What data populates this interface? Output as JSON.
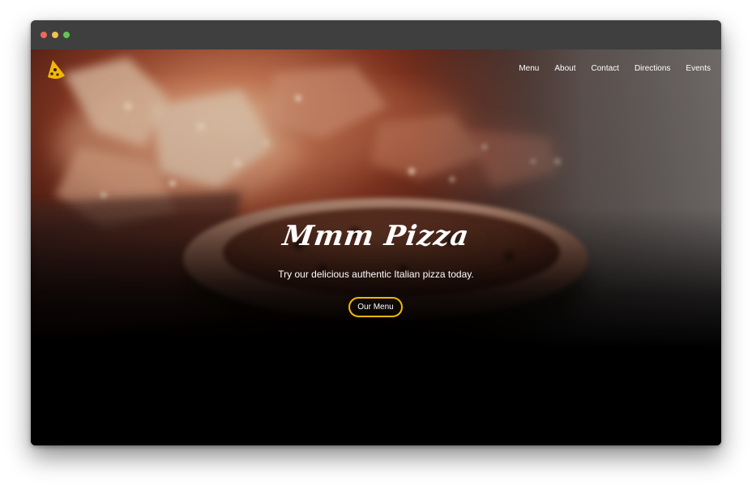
{
  "window": {
    "controls": [
      "close",
      "minimize",
      "maximize"
    ],
    "control_colors": {
      "close": "#ec6a5f",
      "minimize": "#f4bf4f",
      "maximize": "#61c554"
    }
  },
  "site": {
    "logo_icon": "pizza-slice-icon",
    "logo_color": "#f2b705"
  },
  "nav": {
    "items": [
      "Menu",
      "About",
      "Contact",
      "Directions",
      "Events"
    ]
  },
  "hero": {
    "title": "Mmm Pizza",
    "subtitle": "Try our delicious authentic Italian pizza today.",
    "cta_label": "Our Menu",
    "accent_color": "#f2b705"
  }
}
